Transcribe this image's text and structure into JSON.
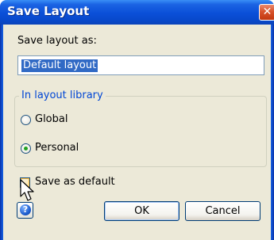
{
  "window": {
    "title": "Save Layout",
    "close_glyph": "✕"
  },
  "form": {
    "name_label": "Save layout as:",
    "name_value": "Default layout"
  },
  "library": {
    "legend": "In layout library",
    "options": [
      {
        "label": "Global",
        "selected": false
      },
      {
        "label": "Personal",
        "selected": true
      }
    ]
  },
  "default_checkbox": {
    "label": "Save as default",
    "checked": false
  },
  "buttons": {
    "help_glyph": "?",
    "ok_label": "OK",
    "cancel_label": "Cancel"
  },
  "colors": {
    "titlebar": "#0a4fd8",
    "dialog_bg": "#ece9d8",
    "selection": "#316ac5",
    "group_legend": "#0046d5",
    "radio_dot": "#21a121",
    "close_button": "#d8532c"
  },
  "icons": {
    "close": "close-icon",
    "help": "help-icon",
    "cursor": "mouse-pointer-icon"
  }
}
